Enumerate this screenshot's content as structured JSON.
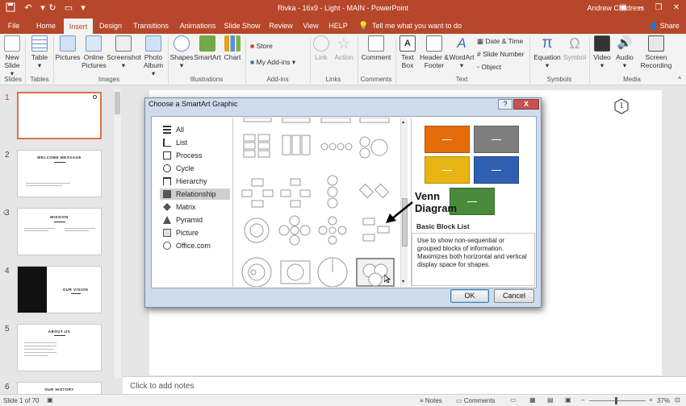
{
  "titlebar": {
    "document_title": "Rivka - 16x9 - Light - MAIN  -  PowerPoint",
    "user_name": "Andrew Childress"
  },
  "tabs": [
    "File",
    "Home",
    "Insert",
    "Design",
    "Transitions",
    "Animations",
    "Slide Show",
    "Review",
    "View",
    "HELP"
  ],
  "active_tab": "Insert",
  "tell_me": "Tell me what you want to do",
  "share_label": "Share",
  "ribbon": {
    "slides": {
      "new_slide": "New Slide",
      "group": "Slides"
    },
    "tables": {
      "table": "Table",
      "group": "Tables"
    },
    "images": {
      "pictures": "Pictures",
      "online_pictures": "Online Pictures",
      "screenshot": "Screenshot",
      "photo_album": "Photo Album",
      "group": "Images"
    },
    "illustrations": {
      "shapes": "Shapes",
      "smartart": "SmartArt",
      "chart": "Chart",
      "group": "Illustrations"
    },
    "addins": {
      "store": "Store",
      "my_addins": "My Add-ins",
      "group": "Add-ins"
    },
    "links": {
      "link": "Link",
      "action": "Action",
      "group": "Links"
    },
    "comments": {
      "comment": "Comment",
      "group": "Comments"
    },
    "text": {
      "text_box": "Text Box",
      "header_footer": "Header & Footer",
      "wordart": "WordArt",
      "date_time": "Date & Time",
      "slide_number": "Slide Number",
      "object": "Object",
      "group": "Text"
    },
    "symbols": {
      "equation": "Equation",
      "symbol": "Symbol",
      "group": "Symbols"
    },
    "media": {
      "video": "Video",
      "audio": "Audio",
      "screen_recording": "Screen Recording",
      "group": "Media"
    }
  },
  "slides": [
    {
      "num": "1",
      "title": ""
    },
    {
      "num": "2",
      "title": "WELCOME MESSAGE"
    },
    {
      "num": "3",
      "title": "MISSION"
    },
    {
      "num": "4",
      "title": "OUR VISION"
    },
    {
      "num": "5",
      "title": "ABOUT US"
    },
    {
      "num": "6",
      "title": "OUR HISTORY"
    }
  ],
  "slide_badge": "1",
  "notes_placeholder": "Click to add notes",
  "status": {
    "slide_count": "Slide 1 of 70",
    "notes": "Notes",
    "comments": "Comments",
    "zoom": "37%"
  },
  "dialog": {
    "title": "Choose a SmartArt Graphic",
    "help": "?",
    "close": "X",
    "categories": [
      "All",
      "List",
      "Process",
      "Cycle",
      "Hierarchy",
      "Relationship",
      "Matrix",
      "Pyramid",
      "Picture",
      "Office.com"
    ],
    "selected_category": "Relationship",
    "preview_title": "Basic Block List",
    "preview_description": "Use to show non-sequential or grouped blocks of information. Maximizes both horizontal and vertical display space for shapes.",
    "ok": "OK",
    "cancel": "Cancel",
    "preview_colors": [
      "#e46c0a",
      "#7f7f7f",
      "#e8b414",
      "#2e5fb0",
      "#4a8a3b"
    ]
  },
  "annotation": {
    "label": "Venn\nDiagram"
  },
  "colors": {
    "accent": "#b7472a"
  }
}
